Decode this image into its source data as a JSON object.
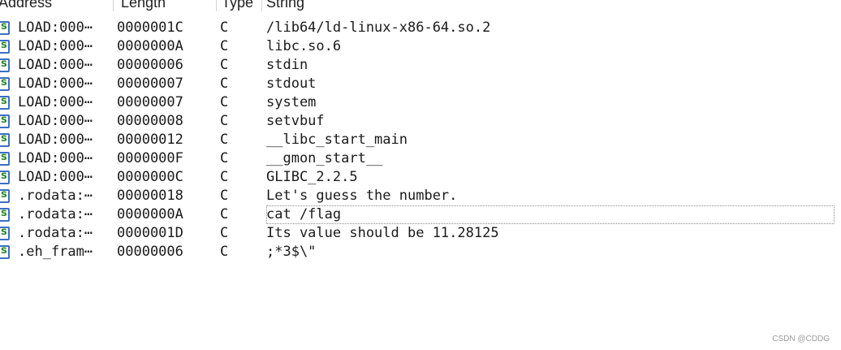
{
  "columns": {
    "address": "Address",
    "length": "Length",
    "type": "Type",
    "string": "String"
  },
  "rows": [
    {
      "icon": "string-icon",
      "address": "LOAD:000⋯",
      "length": "0000001C",
      "type": "C",
      "string": "/lib64/ld-linux-x86-64.so.2"
    },
    {
      "icon": "string-icon",
      "address": "LOAD:000⋯",
      "length": "0000000A",
      "type": "C",
      "string": "libc.so.6"
    },
    {
      "icon": "string-icon",
      "address": "LOAD:000⋯",
      "length": "00000006",
      "type": "C",
      "string": "stdin"
    },
    {
      "icon": "string-icon",
      "address": "LOAD:000⋯",
      "length": "00000007",
      "type": "C",
      "string": "stdout"
    },
    {
      "icon": "string-icon",
      "address": "LOAD:000⋯",
      "length": "00000007",
      "type": "C",
      "string": "system"
    },
    {
      "icon": "string-icon",
      "address": "LOAD:000⋯",
      "length": "00000008",
      "type": "C",
      "string": "setvbuf"
    },
    {
      "icon": "string-icon",
      "address": "LOAD:000⋯",
      "length": "00000012",
      "type": "C",
      "string": "__libc_start_main"
    },
    {
      "icon": "string-icon",
      "address": "LOAD:000⋯",
      "length": "0000000F",
      "type": "C",
      "string": "__gmon_start__"
    },
    {
      "icon": "string-icon",
      "address": "LOAD:000⋯",
      "length": "0000000C",
      "type": "C",
      "string": "GLIBC_2.2.5"
    },
    {
      "icon": "string-icon",
      "address": ".rodata:⋯",
      "length": "00000018",
      "type": "C",
      "string": "Let's guess the number."
    },
    {
      "icon": "string-icon",
      "address": ".rodata:⋯",
      "length": "0000000A",
      "type": "C",
      "string": "cat /flag",
      "selected": true
    },
    {
      "icon": "string-icon",
      "address": ".rodata:⋯",
      "length": "0000001D",
      "type": "C",
      "string": "Its value should be 11.28125"
    },
    {
      "icon": "string-icon",
      "address": ".eh_fram⋯",
      "length": "00000006",
      "type": "C",
      "string": ";*3$\\\""
    }
  ],
  "watermark": "CSDN @CDDG"
}
